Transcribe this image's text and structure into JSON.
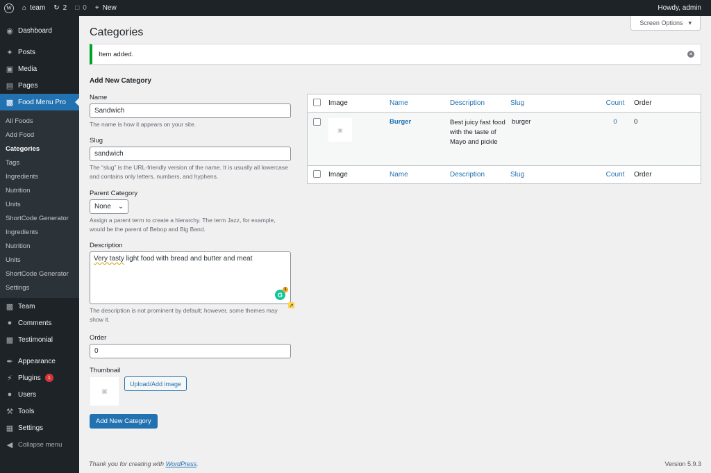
{
  "adminbar": {
    "site_name": "team",
    "updates_count": "2",
    "comments_count": "0",
    "new_label": "New",
    "howdy": "Howdy, admin"
  },
  "sidebar": {
    "dashboard": "Dashboard",
    "posts": "Posts",
    "media": "Media",
    "pages": "Pages",
    "food_menu_pro": "Food Menu Pro",
    "submenu": [
      "All Foods",
      "Add Food",
      "Categories",
      "Tags",
      "Ingredients",
      "Nutrition",
      "Units",
      "ShortCode Generator",
      "Ingredients",
      "Nutrition",
      "Units",
      "ShortCode Generator",
      "Settings"
    ],
    "team": "Team",
    "comments": "Comments",
    "testimonial": "Testimonial",
    "appearance": "Appearance",
    "plugins": "Plugins",
    "plugins_badge": "1",
    "users": "Users",
    "tools": "Tools",
    "settings": "Settings",
    "collapse": "Collapse menu"
  },
  "page": {
    "title": "Categories",
    "screen_options": "Screen Options",
    "notice": "Item added."
  },
  "form": {
    "heading": "Add New Category",
    "name_label": "Name",
    "name_value": "Sandwich",
    "name_desc": "The name is how it appears on your site.",
    "slug_label": "Slug",
    "slug_value": "sandwich",
    "slug_desc": "The “slug” is the URL-friendly version of the name. It is usually all lowercase and contains only letters, numbers, and hyphens.",
    "parent_label": "Parent Category",
    "parent_value": "None",
    "parent_desc": "Assign a parent term to create a hierarchy. The term Jazz, for example, would be the parent of Bebop and Big Band.",
    "description_label": "Description",
    "description_value_underlined": "Very tasty",
    "description_value_rest": " light food with bread and butter and meat",
    "grammarly_count": "1",
    "description_desc": "The description is not prominent by default; however, some themes may show it.",
    "order_label": "Order",
    "order_value": "0",
    "thumbnail_label": "Thumbnail",
    "upload_button": "Upload/Add image",
    "submit_button": "Add New Category"
  },
  "table": {
    "columns": [
      "Image",
      "Name",
      "Description",
      "Slug",
      "Count",
      "Order"
    ],
    "rows": [
      {
        "name": "Burger",
        "description": "Best juicy fast food with the taste of Mayo and pickle",
        "slug": "burger",
        "count": "0",
        "order": "0"
      }
    ]
  },
  "footer": {
    "thanks_prefix": "Thank you for creating with ",
    "wordpress": "WordPress",
    "thanks_suffix": ".",
    "version": "Version 5.9.3"
  }
}
